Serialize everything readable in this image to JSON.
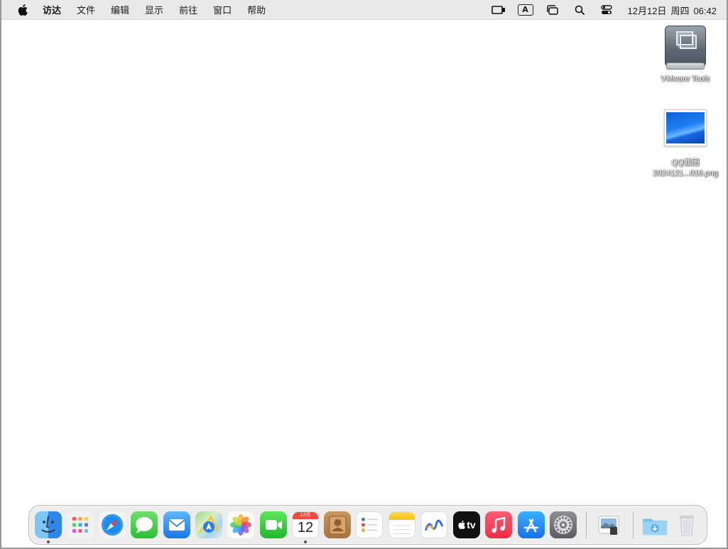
{
  "menubar": {
    "app_name": "访达",
    "items": [
      "文件",
      "编辑",
      "显示",
      "前往",
      "窗口",
      "帮助"
    ],
    "input_method": "A",
    "clock": {
      "date": "12月12日",
      "weekday": "周四",
      "time": "06:42"
    }
  },
  "desktop": {
    "icons": [
      {
        "label": "VMware Tools",
        "icon": "disk-icon"
      },
      {
        "label_line1": "QQ截图",
        "label_line2": "2024121...018.png",
        "icon": "image-thumbnail"
      }
    ]
  },
  "dock": {
    "apps": [
      {
        "name": "finder",
        "running": true
      },
      {
        "name": "launchpad"
      },
      {
        "name": "safari"
      },
      {
        "name": "messages"
      },
      {
        "name": "mail"
      },
      {
        "name": "maps"
      },
      {
        "name": "photos"
      },
      {
        "name": "facetime"
      },
      {
        "name": "calendar",
        "month": "12月",
        "day": "12",
        "running": true
      },
      {
        "name": "contacts"
      },
      {
        "name": "reminders"
      },
      {
        "name": "notes"
      },
      {
        "name": "freeform"
      },
      {
        "name": "tv",
        "label": "tv"
      },
      {
        "name": "music"
      },
      {
        "name": "app-store"
      },
      {
        "name": "system-settings"
      },
      {
        "name": "preview"
      },
      {
        "name": "downloads-folder"
      },
      {
        "name": "trash"
      }
    ]
  },
  "colors": {
    "menubar_bg": "#e9e9e9",
    "desktop_bg": "#ffffff",
    "dock_bg": "#ececec"
  }
}
